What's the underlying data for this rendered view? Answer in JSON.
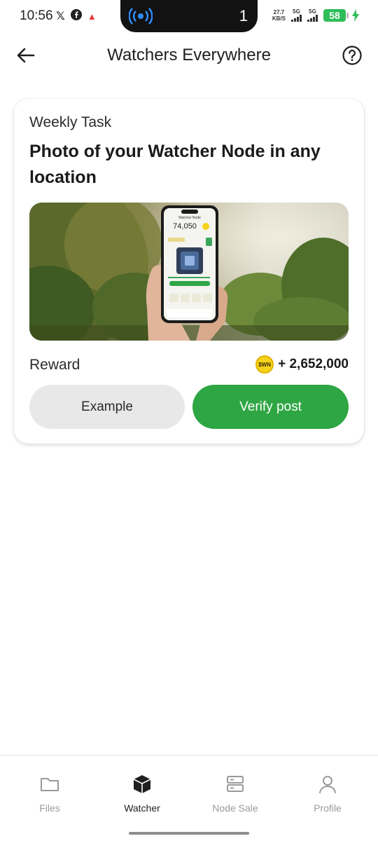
{
  "status_bar": {
    "time": "10:56",
    "left_icons": [
      "x-logo-icon",
      "facebook-icon",
      "adobe-icon"
    ],
    "island_count": "1",
    "net_speed_top": "27.7",
    "net_speed_bottom": "KB/S",
    "signal_1": "5G",
    "signal_2": "5G",
    "battery": "58"
  },
  "header": {
    "title": "Watchers Everywhere"
  },
  "task": {
    "eyebrow": "Weekly Task",
    "title": "Photo of your Watcher Node in any location",
    "hero_phone": {
      "app_title": "Watcher Node",
      "balance": "74,050"
    },
    "reward_label": "Reward",
    "coin_label": "$WN",
    "reward_amount": "+ 2,652,000",
    "example_button": "Example",
    "verify_button": "Verify post"
  },
  "bottom_nav": {
    "items": [
      {
        "label": "Files",
        "icon": "folder-icon",
        "active": false
      },
      {
        "label": "Watcher",
        "icon": "cube-icon",
        "active": true
      },
      {
        "label": "Node Sale",
        "icon": "server-icon",
        "active": false
      },
      {
        "label": "Profile",
        "icon": "person-icon",
        "active": false
      }
    ]
  },
  "colors": {
    "accent_green": "#2ea644",
    "battery_green": "#2ebd59",
    "coin_yellow": "#f6d31b"
  }
}
